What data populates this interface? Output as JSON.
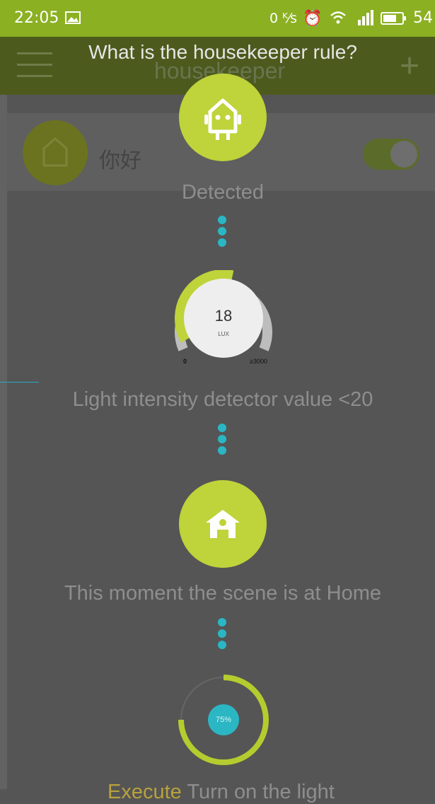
{
  "status_bar": {
    "time": "22:05",
    "net_speed": "0 ᴷ⁄s",
    "battery": "54",
    "icons": [
      "image-icon",
      "alarm-icon",
      "wifi-icon",
      "signal-icon",
      "battery-icon"
    ]
  },
  "background_app": {
    "title": "housekeeper",
    "item_name": "你好",
    "toggle_on": true
  },
  "overlay": {
    "title": "What is the housekeeper rule?",
    "step1_label": "Detected",
    "step2_value": "18",
    "step2_unit": "LUX",
    "step2_min": "0",
    "step2_max": "≥3000",
    "step2_level": 0.55,
    "step2_label": "Light intensity detector value <20",
    "step3_label": "This moment the scene is at Home",
    "step4_percent": "75%",
    "step4_level": 0.75,
    "step4_label_accent": "Execute",
    "step4_label": "Turn on the light"
  },
  "colors": {
    "accent_green": "#bfd33a",
    "status_green": "#8bb022",
    "dot_teal": "#2bb6c4",
    "overlay_bg": "#555555"
  }
}
